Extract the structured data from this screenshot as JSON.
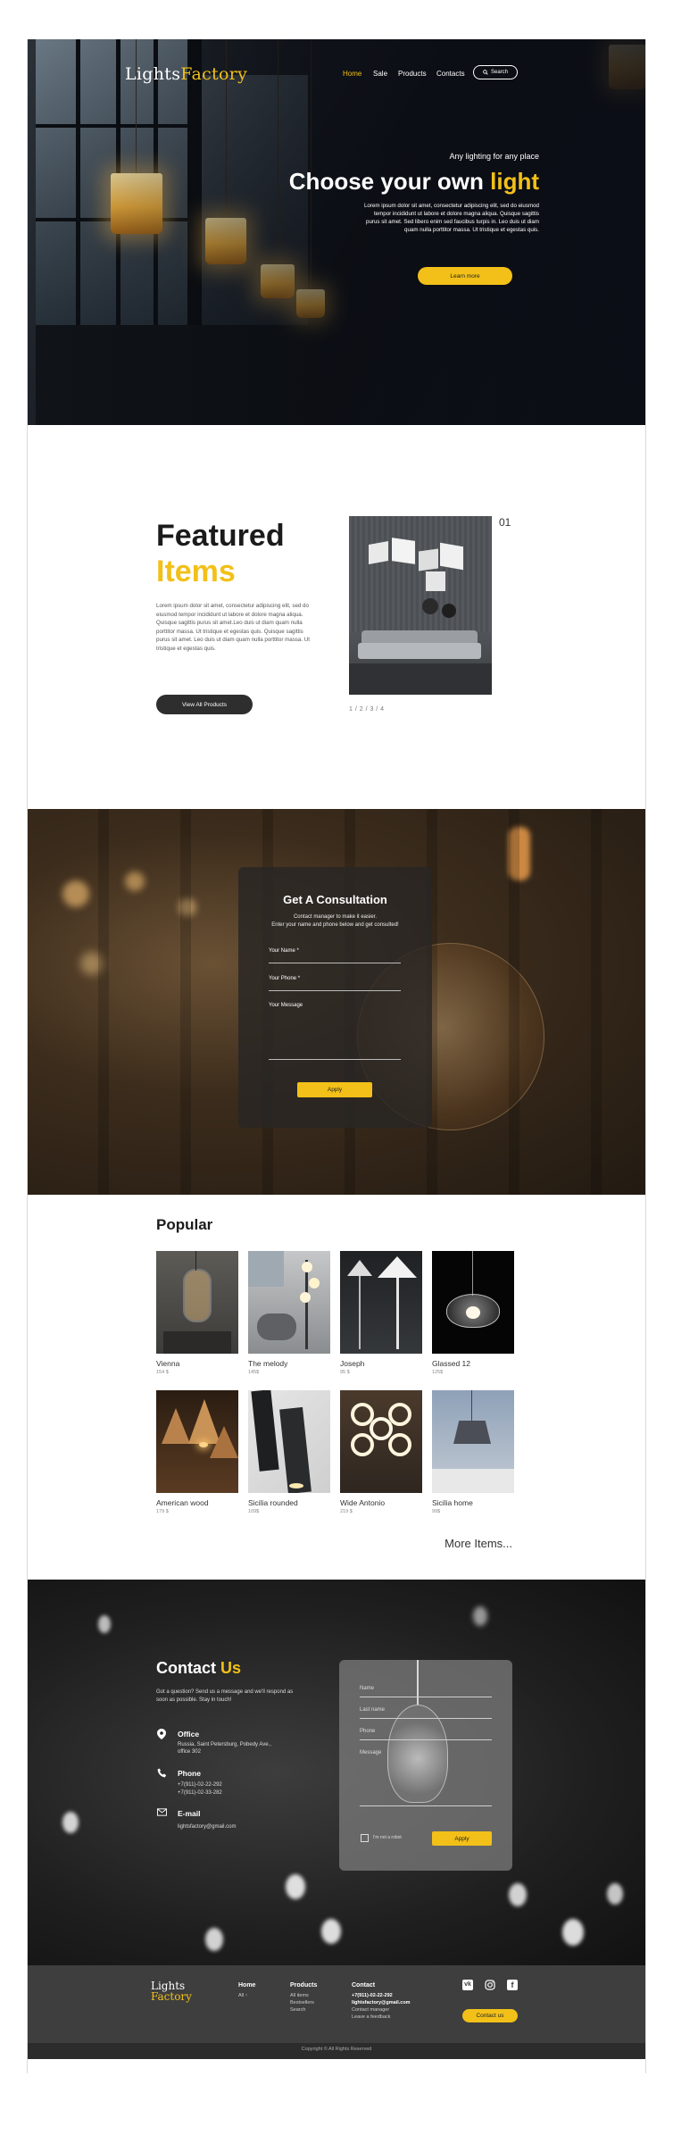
{
  "brand": {
    "logo_part1": "Lights",
    "logo_part2": "Factory",
    "accent": "#f2c018"
  },
  "nav": {
    "items": [
      "Home",
      "Sale",
      "Products",
      "Contacts"
    ],
    "active": "Home",
    "search_label": "Search"
  },
  "hero": {
    "subtitle": "Any lighting for any place",
    "title_part1": "Choose your own ",
    "title_part2": "light",
    "text": "Lorem ipsum dolor sit amet, consectetur adipiscing elit, sed do eiusmod tempor incididunt ut labore et dolore magna aliqua. Quisque sagittis purus sit amet. Sed libero enim sed faucibus turpis in. Leo duis ut diam quam nulla porttitor massa. Ut tristique et egestas quis.",
    "button": "Learn more"
  },
  "featured": {
    "title_part1": "Featured",
    "title_part2": "Items",
    "text": "Lorem ipsum dolor sit amet, consectetur adipiscing elit, sed do eiusmod tempor incididunt ut labore et dolore magna aliqua. Quisque sagittis purus sit amet.Leo duis ut diam quam nulla porttitor massa. Ut tristique et egestas quis. Quisque sagittis purus sit amet. Leo duis ut diam quam nulla porttitor massa. Ut tristique et egestas quis.",
    "button": "View All Products",
    "index": "01",
    "pages": "1 / 2 / 3 / 4"
  },
  "consultation": {
    "title": "Get A Consultation",
    "subtitle_line1": "Contact manager to make it easier.",
    "subtitle_line2": "Enter your name and phone below and get consulted!",
    "name_label": "Your Name *",
    "phone_label": "Your Phone *",
    "message_label": "Your Message",
    "button": "Apply"
  },
  "popular": {
    "title": "Popular",
    "items": [
      {
        "name": "Vienna",
        "price": "154 $"
      },
      {
        "name": "The melody",
        "price": "145$"
      },
      {
        "name": "Joseph",
        "price": "95 $"
      },
      {
        "name": "Glassed 12",
        "price": "125$"
      },
      {
        "name": "American wood",
        "price": "179 $"
      },
      {
        "name": "Sicilia rounded",
        "price": "109$"
      },
      {
        "name": "Wide Antonio",
        "price": "219 $"
      },
      {
        "name": "Sicilia home",
        "price": "99$"
      }
    ],
    "more": "More Items..."
  },
  "contact": {
    "title_part1": "Contact ",
    "title_part2": "Us",
    "text": "Got a question? Send us a message and we'll respond as soon as possible. Stay in touch!",
    "office_head": "Office",
    "office_val": "Russia, Saint Petersburg, Pobedy Ave., office 302",
    "phone_head": "Phone",
    "phone_val1": "+7(911)-02-22-292",
    "phone_val2": "+7(911)-02-33-282",
    "email_head": "E-mail",
    "email_val": "lightsfactory@gmail.com",
    "form": {
      "name_label": "Name",
      "lastname_label": "Last name",
      "phone_label": "Phone",
      "message_label": "Message",
      "not_robot": "I'm not a robot",
      "button": "Apply"
    }
  },
  "footer": {
    "logo_part1": "Lights",
    "logo_part2": "Factory",
    "home_head": "Home",
    "home_items": [
      "All ↑"
    ],
    "products_head": "Products",
    "products_items": [
      "All items",
      "Bestsellers",
      "Search"
    ],
    "contact_head": "Contact",
    "contact_items": [
      "+7(911)-02-22-292",
      "lightsfactory@gmail.com",
      "Contact manager",
      "Leave a feedback"
    ],
    "contact_button": "Contact us",
    "social_icons": [
      "vk-icon",
      "instagram-icon",
      "facebook-icon"
    ],
    "copyright": "Copyright © All Rights Reserved"
  }
}
